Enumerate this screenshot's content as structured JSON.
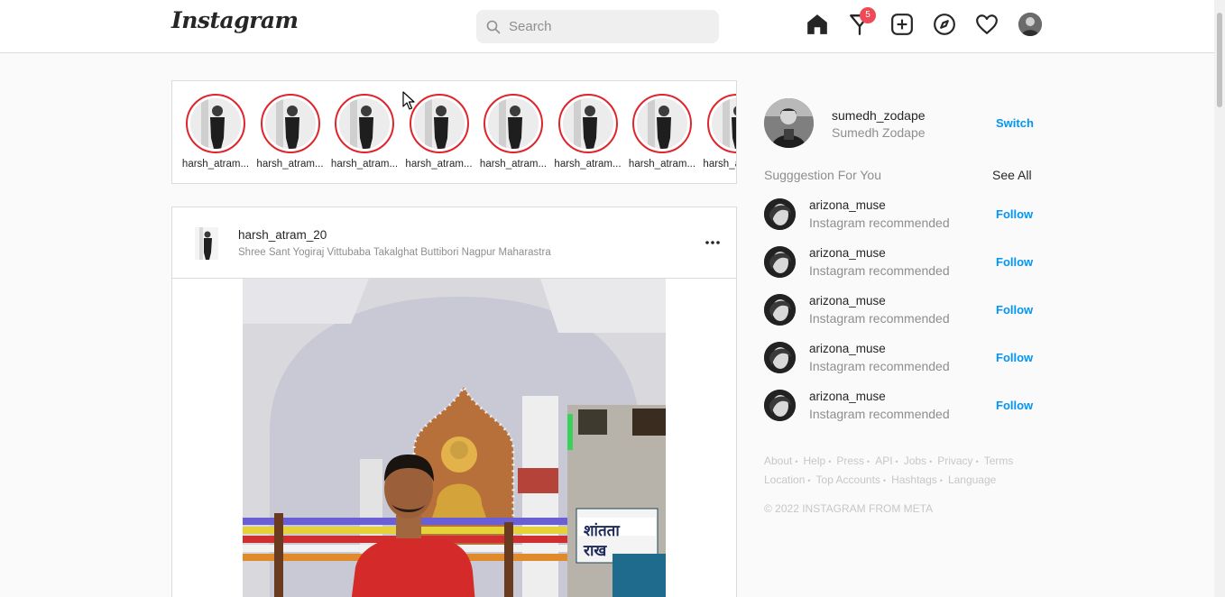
{
  "header": {
    "logo": "Instagram",
    "search_placeholder": "Search",
    "notification_count": "5",
    "icons": [
      "home-icon",
      "direct-message-icon",
      "new-post-icon",
      "explore-icon",
      "activity-heart-icon",
      "profile-avatar"
    ]
  },
  "stories": [
    {
      "username": "harsh_atram..."
    },
    {
      "username": "harsh_atram..."
    },
    {
      "username": "harsh_atram..."
    },
    {
      "username": "harsh_atram..."
    },
    {
      "username": "harsh_atram..."
    },
    {
      "username": "harsh_atram..."
    },
    {
      "username": "harsh_atram..."
    },
    {
      "username": "harsh_atram..."
    }
  ],
  "post": {
    "username": "harsh_atram_20",
    "location": "Shree Sant Yogiraj Vittubaba Takalghat Buttibori Nagpur Maharastra"
  },
  "sidebar": {
    "username": "sumedh_zodape",
    "full_name": "Sumedh Zodape",
    "switch_label": "Switch",
    "suggestions_title": "Sugggestion For You",
    "see_all_label": "See All",
    "suggestions": [
      {
        "username": "arizona_muse",
        "subtitle": "Instagram recommended",
        "action": "Follow"
      },
      {
        "username": "arizona_muse",
        "subtitle": "Instagram recommended",
        "action": "Follow"
      },
      {
        "username": "arizona_muse",
        "subtitle": "Instagram recommended",
        "action": "Follow"
      },
      {
        "username": "arizona_muse",
        "subtitle": "Instagram recommended",
        "action": "Follow"
      },
      {
        "username": "arizona_muse",
        "subtitle": "Instagram recommended",
        "action": "Follow"
      }
    ],
    "footer_row1": [
      "About",
      "Help",
      "Press",
      "API",
      "Jobs",
      "Privacy",
      "Terms"
    ],
    "footer_row2": [
      "Location",
      "Top Accounts",
      "Hashtags",
      "Language"
    ],
    "copyright": "© 2022 INSTAGRAM FROM META"
  },
  "colors": {
    "accent": "#0095f6",
    "story_ring": "#e0242c",
    "badge": "#ed4956",
    "background": "#fafafa"
  }
}
